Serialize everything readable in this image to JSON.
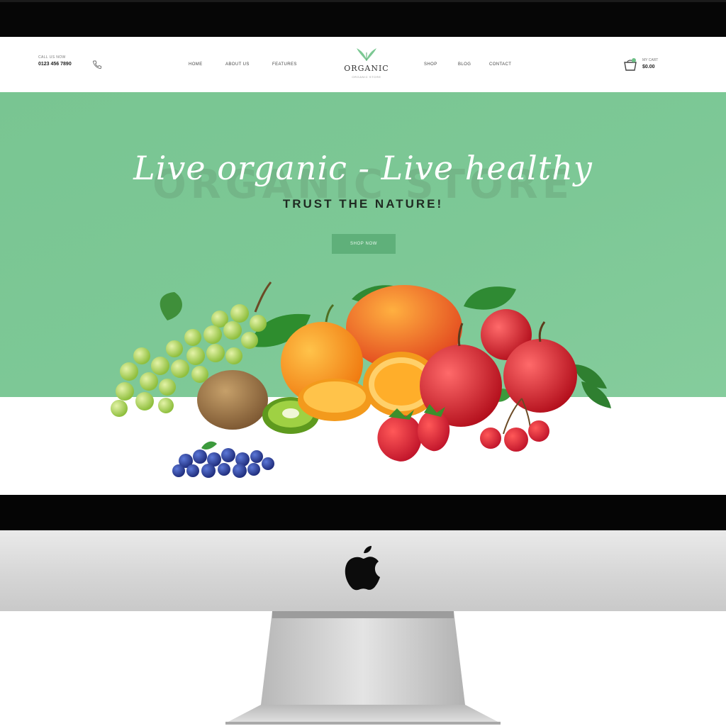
{
  "header": {
    "call_label": "CALL US NOW",
    "phone_number": "0123 456 7890",
    "nav_left": [
      "HOME",
      "ABOUT US",
      "FEATURES"
    ],
    "nav_right": [
      "SHOP",
      "BLOG",
      "CONTACT"
    ],
    "brand_name": "ORGANIC",
    "brand_tagline": "ORGANIC STORE",
    "cart_label": "MY CART",
    "cart_amount": "$0.00"
  },
  "hero": {
    "watermark": "ORGANIC STORE",
    "script_title": "Live organic - Live healthy",
    "subtitle": "TRUST THE NATURE!",
    "button_label": "SHOP NOW"
  },
  "icons": {
    "phone": "phone-icon",
    "cart": "cart-icon",
    "brand_leaf": "leaf-icon",
    "hardware_logo": "apple-logo-icon"
  },
  "colors": {
    "hero_green": "#7dc896",
    "button_green": "#5fb07a",
    "header_bg": "#ffffff",
    "bezel": "#060606"
  }
}
